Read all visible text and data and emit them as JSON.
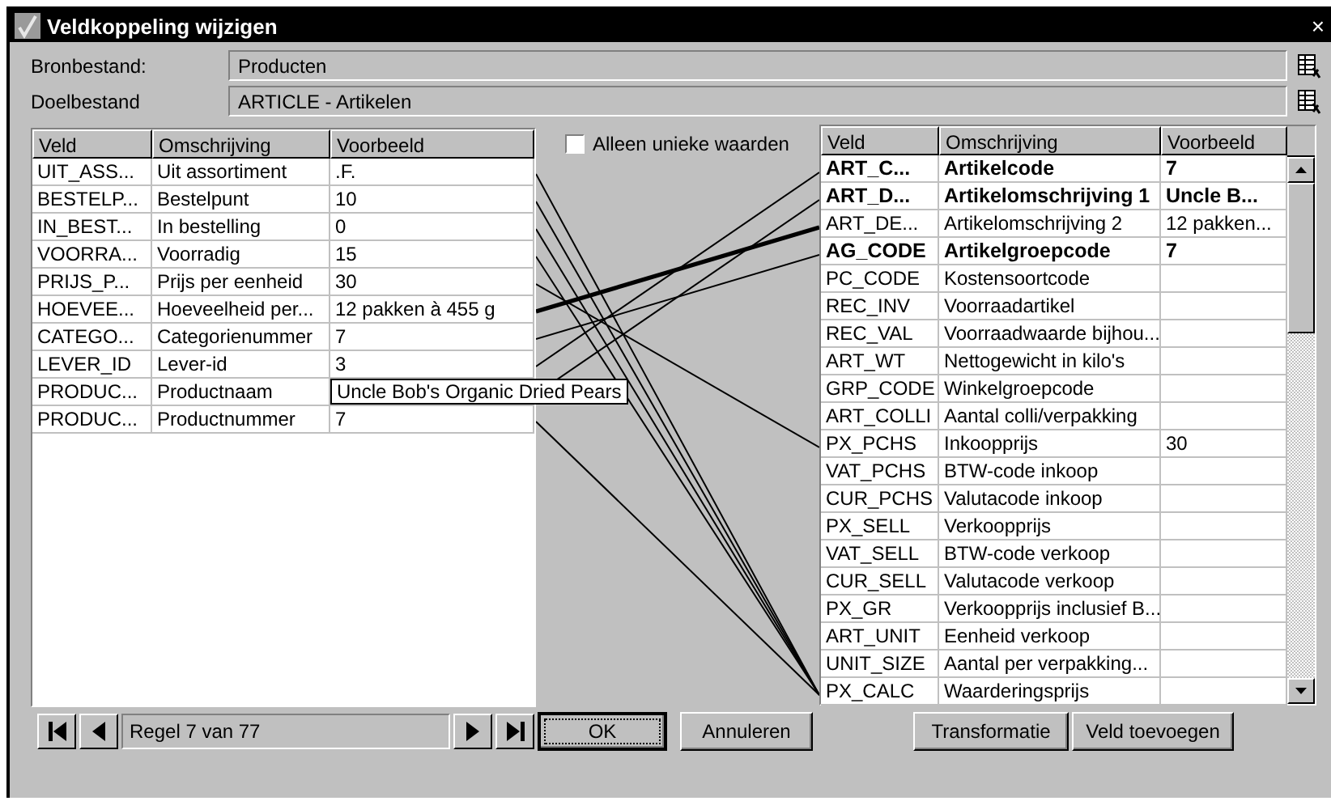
{
  "window": {
    "title": "Veldkoppeling wijzigen",
    "close": "×"
  },
  "source": {
    "label": "Bronbestand:",
    "value": "Producten"
  },
  "target": {
    "label": "Doelbestand",
    "value": "ARTICLE - Artikelen"
  },
  "unique_only": {
    "label": "Alleen unieke waarden",
    "checked": false
  },
  "source_table": {
    "columns": [
      "Veld",
      "Omschrijving",
      "Voorbeeld"
    ],
    "rows": [
      {
        "veld": "UIT_ASS...",
        "omschrijving": "Uit assortiment",
        "voorbeeld": ".F.",
        "tooltip": false
      },
      {
        "veld": "BESTELP...",
        "omschrijving": "Bestelpunt",
        "voorbeeld": "10",
        "tooltip": false
      },
      {
        "veld": "IN_BEST...",
        "omschrijving": "In bestelling",
        "voorbeeld": "0",
        "tooltip": false
      },
      {
        "veld": "VOORRA...",
        "omschrijving": "Voorradig",
        "voorbeeld": "15",
        "tooltip": false
      },
      {
        "veld": "PRIJS_P...",
        "omschrijving": "Prijs per eenheid",
        "voorbeeld": "30",
        "tooltip": false
      },
      {
        "veld": "HOEVEE...",
        "omschrijving": "Hoeveelheid per...",
        "voorbeeld": "12 pakken à 455 g",
        "tooltip": false
      },
      {
        "veld": "CATEGO...",
        "omschrijving": "Categorienummer",
        "voorbeeld": "7",
        "tooltip": false
      },
      {
        "veld": "LEVER_ID",
        "omschrijving": "Lever-id",
        "voorbeeld": "3",
        "tooltip": false
      },
      {
        "veld": "PRODUC...",
        "omschrijving": "Productnaam",
        "voorbeeld": "Uncle Bob's Organic Dried Pears",
        "tooltip": true
      },
      {
        "veld": "PRODUC...",
        "omschrijving": "Productnummer",
        "voorbeeld": "7",
        "tooltip": false
      }
    ]
  },
  "target_table": {
    "columns": [
      "Veld",
      "Omschrijving",
      "Voorbeeld"
    ],
    "rows": [
      {
        "veld": "ART_C...",
        "omschrijving": "Artikelcode",
        "voorbeeld": "7",
        "bold": true
      },
      {
        "veld": "ART_D...",
        "omschrijving": "Artikelomschrijving 1",
        "voorbeeld": "Uncle B...",
        "bold": true
      },
      {
        "veld": "ART_DE...",
        "omschrijving": "Artikelomschrijving 2",
        "voorbeeld": "12 pakken...",
        "bold": false
      },
      {
        "veld": "AG_CODE",
        "omschrijving": "Artikelgroepcode",
        "voorbeeld": "7",
        "bold": true
      },
      {
        "veld": "PC_CODE",
        "omschrijving": "Kostensoortcode",
        "bold": false
      },
      {
        "veld": "REC_INV",
        "omschrijving": "Voorraadartikel",
        "bold": false
      },
      {
        "veld": "REC_VAL",
        "omschrijving": "Voorraadwaarde bijhou...",
        "bold": false
      },
      {
        "veld": "ART_WT",
        "omschrijving": "Nettogewicht in kilo's",
        "bold": false
      },
      {
        "veld": "GRP_CODE",
        "omschrijving": "Winkelgroepcode",
        "bold": false
      },
      {
        "veld": "ART_COLLI",
        "omschrijving": "Aantal colli/verpakking",
        "bold": false
      },
      {
        "veld": "PX_PCHS",
        "omschrijving": "Inkoopprijs",
        "voorbeeld": "30",
        "bold": false
      },
      {
        "veld": "VAT_PCHS",
        "omschrijving": "BTW-code inkoop",
        "bold": false
      },
      {
        "veld": "CUR_PCHS",
        "omschrijving": "Valutacode inkoop",
        "bold": false
      },
      {
        "veld": "PX_SELL",
        "omschrijving": "Verkoopprijs",
        "bold": false
      },
      {
        "veld": "VAT_SELL",
        "omschrijving": "BTW-code verkoop",
        "bold": false
      },
      {
        "veld": "CUR_SELL",
        "omschrijving": "Valutacode verkoop",
        "bold": false
      },
      {
        "veld": "PX_GR",
        "omschrijving": "Verkoopprijs inclusief B...",
        "bold": false
      },
      {
        "veld": "ART_UNIT",
        "omschrijving": "Eenheid verkoop",
        "bold": false
      },
      {
        "veld": "UNIT_SIZE",
        "omschrijving": "Aantal per verpakking...",
        "bold": false
      },
      {
        "veld": "PX_CALC",
        "omschrijving": "Waarderingsprijs",
        "bold": false
      }
    ]
  },
  "navigator": {
    "record": "Regel 7 van 77"
  },
  "buttons": [
    {
      "label": "OK",
      "default": true
    },
    {
      "label": "Annuleren",
      "default": false
    },
    {
      "label": "Transformatie",
      "default": false
    },
    {
      "label": "Veld toevoegen",
      "default": false
    }
  ]
}
